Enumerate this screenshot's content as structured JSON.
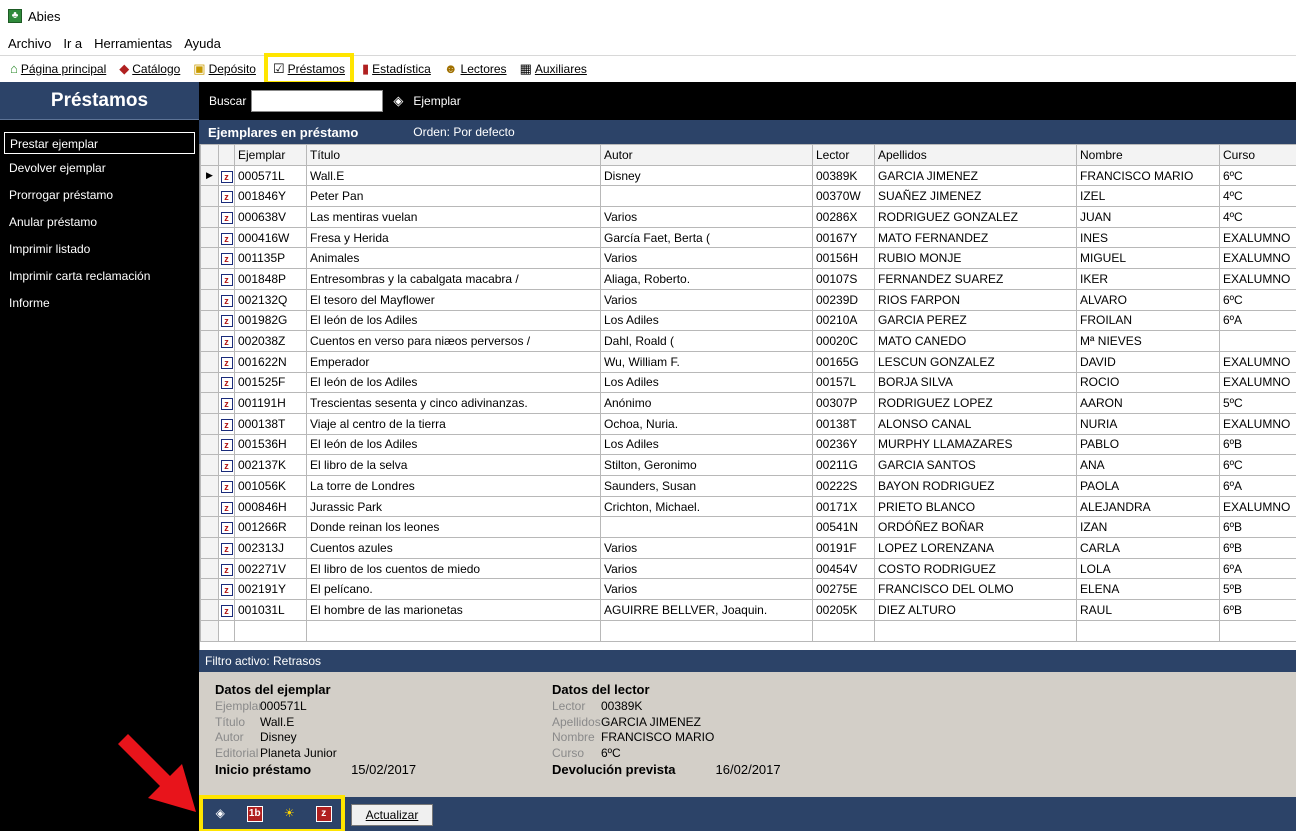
{
  "window": {
    "title": "Abies",
    "icon": "tree-icon"
  },
  "menu": [
    "Archivo",
    "Ir a",
    "Herramientas",
    "Ayuda"
  ],
  "toolbar": [
    {
      "label": "Página principal",
      "icon": "home-icon"
    },
    {
      "label": "Catálogo",
      "icon": "catalog-icon"
    },
    {
      "label": "Depósito",
      "icon": "deposit-icon"
    },
    {
      "label": "Préstamos",
      "icon": "checkbox-icon",
      "active": true
    },
    {
      "label": "Estadística",
      "icon": "chart-icon"
    },
    {
      "label": "Lectores",
      "icon": "readers-icon"
    },
    {
      "label": "Auxiliares",
      "icon": "table-icon"
    }
  ],
  "sidebar": {
    "title": "Préstamos",
    "items": [
      "Prestar ejemplar",
      "Devolver ejemplar",
      "Prorrogar préstamo",
      "Anular préstamo",
      "Imprimir listado",
      "Imprimir carta reclamación",
      "Informe"
    ]
  },
  "search": {
    "label": "Buscar",
    "value": "",
    "mode": "Ejemplar"
  },
  "grid": {
    "title": "Ejemplares en préstamo",
    "order": "Orden: Por defecto",
    "columns": [
      "Ejemplar",
      "Título",
      "Autor",
      "Lector",
      "Apellidos",
      "Nombre",
      "Curso"
    ],
    "rows": [
      [
        "000571L",
        "Wall.E",
        "Disney",
        "00389K",
        "GARCIA JIMENEZ",
        "FRANCISCO MARIO",
        "6ºC"
      ],
      [
        "001846Y",
        "Peter Pan",
        "",
        "00370W",
        "SUAÑEZ JIMENEZ",
        "IZEL",
        "4ºC"
      ],
      [
        "000638V",
        "Las mentiras vuelan",
        "Varios",
        "00286X",
        "RODRIGUEZ GONZALEZ",
        "JUAN",
        "4ºC"
      ],
      [
        "000416W",
        "Fresa y Herida",
        "García Faet, Berta (",
        "00167Y",
        "MATO FERNANDEZ",
        "INES",
        "EXALUMNO"
      ],
      [
        "001135P",
        "Animales",
        "Varios",
        "00156H",
        "RUBIO MONJE",
        "MIGUEL",
        "EXALUMNO"
      ],
      [
        "001848P",
        "Entresombras y la cabalgata macabra /",
        "Aliaga, Roberto.",
        "00107S",
        "FERNANDEZ SUAREZ",
        "IKER",
        "EXALUMNO"
      ],
      [
        "002132Q",
        "El tesoro del Mayflower",
        "Varios",
        "00239D",
        "RIOS FARPON",
        "ALVARO",
        "6ºC"
      ],
      [
        "001982G",
        "El león de los Adiles",
        "Los Adiles",
        "00210A",
        "GARCIA PEREZ",
        "FROILAN",
        "6ºA"
      ],
      [
        "002038Z",
        "Cuentos en verso para niæos perversos /",
        "Dahl, Roald (",
        "00020C",
        "MATO CANEDO",
        "Mª NIEVES",
        ""
      ],
      [
        "001622N",
        "Emperador",
        "Wu, William F.",
        "00165G",
        "LESCUN GONZALEZ",
        "DAVID",
        "EXALUMNO"
      ],
      [
        "001525F",
        "El león de los Adiles",
        "Los Adiles",
        "00157L",
        "BORJA SILVA",
        "ROCIO",
        "EXALUMNO"
      ],
      [
        "001191H",
        "Trescientas sesenta y cinco adivinanzas.",
        "Anónimo",
        "00307P",
        "RODRIGUEZ LOPEZ",
        "AARON",
        "5ºC"
      ],
      [
        "000138T",
        "Viaje al centro de la tierra",
        "Ochoa, Nuria.",
        "00138T",
        "ALONSO CANAL",
        "NURIA",
        "EXALUMNO"
      ],
      [
        "001536H",
        "El león de los Adiles",
        "Los Adiles",
        "00236Y",
        "MURPHY LLAMAZARES",
        "PABLO",
        "6ºB"
      ],
      [
        "002137K",
        "El libro de la selva",
        "Stilton, Geronimo",
        "00211G",
        "GARCIA SANTOS",
        "ANA",
        "6ºC"
      ],
      [
        "001056K",
        "La torre de Londres",
        "Saunders, Susan",
        "00222S",
        "BAYON RODRIGUEZ",
        "PAOLA",
        "6ºA"
      ],
      [
        "000846H",
        "Jurassic Park",
        "Crichton, Michael.",
        "00171X",
        "PRIETO BLANCO",
        "ALEJANDRA",
        "EXALUMNO"
      ],
      [
        "001266R",
        "Donde reinan los leones",
        "",
        "00541N",
        "ORDÓÑEZ BOÑAR",
        "IZAN",
        "6ºB"
      ],
      [
        "002313J",
        "Cuentos azules",
        "Varios",
        "00191F",
        "LOPEZ LORENZANA",
        "CARLA",
        "6ºB"
      ],
      [
        "002271V",
        "El libro de los cuentos de miedo",
        "Varios",
        "00454V",
        "COSTO RODRIGUEZ",
        "LOLA",
        "6ºA"
      ],
      [
        "002191Y",
        "El pelícano.",
        "Varios",
        "00275E",
        "FRANCISCO DEL OLMO",
        "ELENA",
        "5ºB"
      ],
      [
        "001031L",
        "El hombre de las marionetas",
        "AGUIRRE BELLVER, Joaquin.",
        "00205K",
        "DIEZ ALTURO",
        "RAUL",
        "6ºB"
      ]
    ]
  },
  "filter": "Filtro activo: Retrasos",
  "details": {
    "copy": {
      "heading": "Datos del ejemplar",
      "fields": [
        {
          "label": "Ejemplar",
          "value": "000571L"
        },
        {
          "label": "Título",
          "value": "Wall.E"
        },
        {
          "label": "Autor",
          "value": "Disney"
        },
        {
          "label": "Editorial",
          "value": "Planeta Junior"
        }
      ],
      "start_label": "Inicio préstamo",
      "start_date": "15/02/2017"
    },
    "reader": {
      "heading": "Datos del lector",
      "fields": [
        {
          "label": "Lector",
          "value": "00389K"
        },
        {
          "label": "Apellidos",
          "value": "GARCIA JIMENEZ"
        },
        {
          "label": "Nombre",
          "value": "FRANCISCO MARIO"
        },
        {
          "label": "Curso",
          "value": "6ºC"
        }
      ],
      "due_label": "Devolución prevista",
      "due_date": "16/02/2017"
    }
  },
  "bottom": {
    "icons": [
      "eraser-icon",
      "book-1b-icon",
      "bulb-icon",
      "z-book-icon"
    ],
    "refresh_label": "Actualizar"
  },
  "colors": {
    "highlight": "#ffe500",
    "arrow": "#e8141b",
    "panel": "#2c4368"
  }
}
